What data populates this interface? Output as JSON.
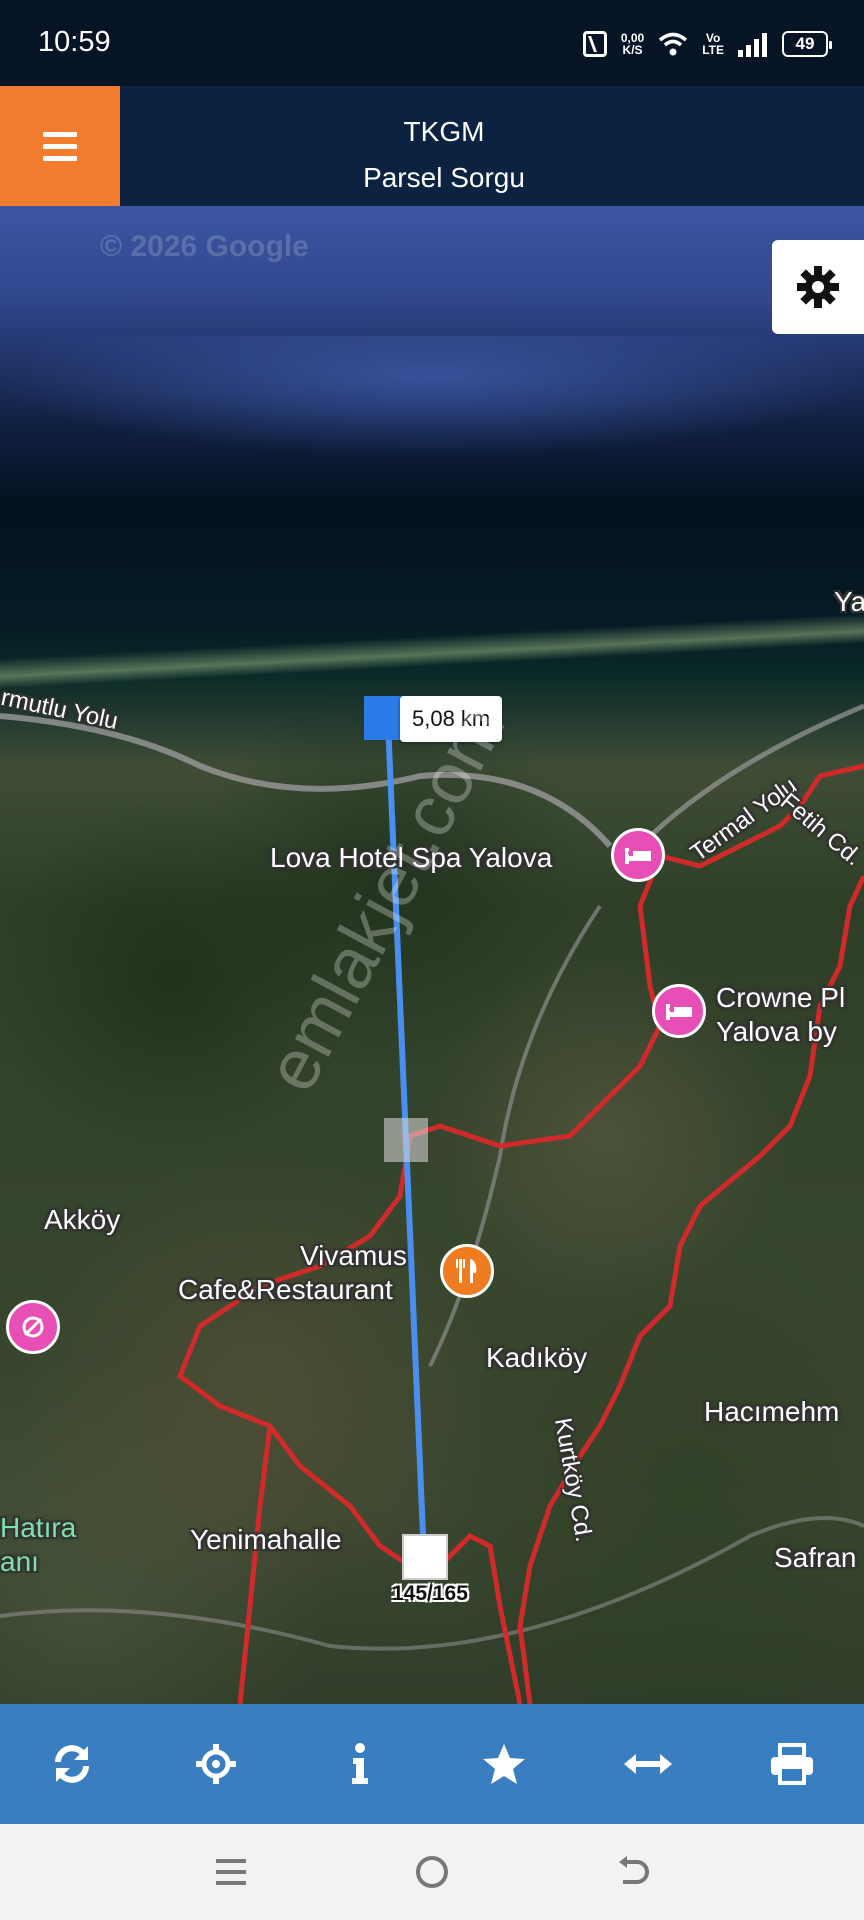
{
  "status_bar": {
    "time": "10:59",
    "net_speed_value": "0,00",
    "net_speed_unit": "K/S",
    "volte_top": "Vo",
    "volte_bottom": "LTE",
    "battery": "49"
  },
  "header": {
    "title": "TKGM",
    "subtitle": "Parsel Sorgu",
    "menu_icon": "hamburger-icon",
    "accent_color": "#f47c2e",
    "background_color": "#0b2240"
  },
  "map": {
    "copyright": "© 2026 Google",
    "watermark": "emlakjet.com",
    "settings_icon": "gear-icon",
    "measure": {
      "distance": "5,08 km",
      "parcel": "145/165",
      "line_color": "#4a8ff0"
    },
    "labels": {
      "armutlu_yolu": "rmutlu Yolu",
      "lova_hotel": "Lova Hotel Spa Yalova",
      "termal_yolu": "Termal Yolu",
      "fetih_cd": "Fetih Cd.",
      "crowne_line1": "Crowne Pl",
      "crowne_line2": "Yalova by",
      "akkoy": "Akköy",
      "vivamus_line1": "Vivamus",
      "vivamus_line2": "Cafe&Restaurant",
      "kadikoy": "Kadıköy",
      "kurtkoy_cd": "Kurtköy Cd.",
      "hacimehm": "Hacımehm",
      "hatira_line1": "Hatıra",
      "hatira_line2": "anı",
      "yenimahalle": "Yenimahalle",
      "safran": "Safran",
      "ya": "Ya"
    },
    "boundary_color": "#d02a2a"
  },
  "toolbar": {
    "background_color": "#3a7ec2",
    "items": [
      {
        "icon": "refresh-icon"
      },
      {
        "icon": "locate-icon"
      },
      {
        "icon": "info-icon"
      },
      {
        "icon": "star-icon"
      },
      {
        "icon": "measure-icon"
      },
      {
        "icon": "print-icon"
      }
    ]
  },
  "nav_bar": {
    "items": [
      {
        "icon": "recent-apps-icon"
      },
      {
        "icon": "home-icon"
      },
      {
        "icon": "back-icon"
      }
    ]
  }
}
